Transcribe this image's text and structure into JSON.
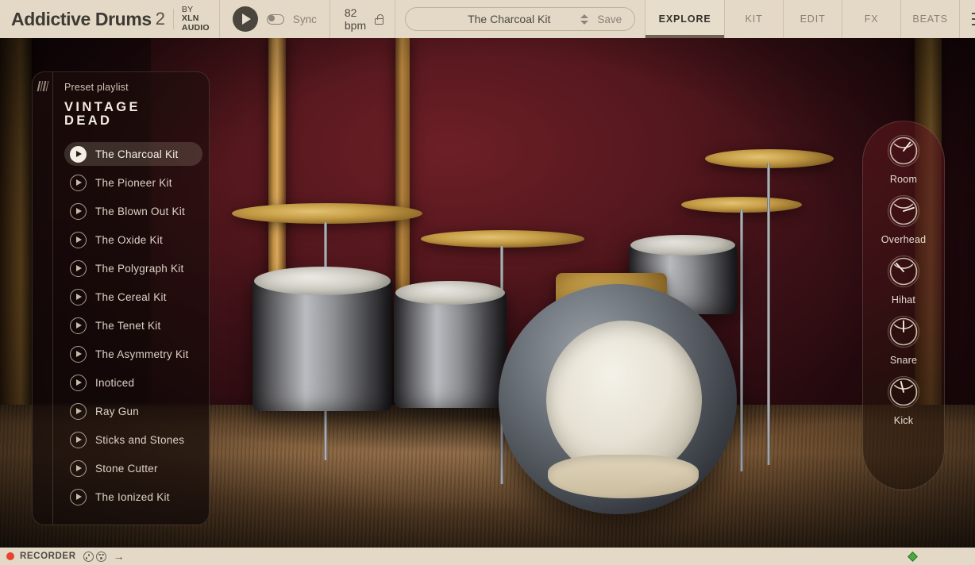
{
  "app": {
    "brand_name": "Addictive Drums",
    "brand_version": "2",
    "by_line1_prefix": "BY ",
    "by_line1_bold": "XLN",
    "by_line2": "AUDIO"
  },
  "transport": {
    "play_icon": "play-icon",
    "sync_label": "Sync",
    "sync_on": false,
    "bpm": "82 bpm",
    "lock_icon": "unlock-icon"
  },
  "preset": {
    "name": "The Charcoal Kit",
    "save_label": "Save",
    "stepper_icon": "chevron-up-down-icon"
  },
  "tabs": [
    {
      "label": "EXPLORE",
      "active": true
    },
    {
      "label": "KIT",
      "active": false
    },
    {
      "label": "EDIT",
      "active": false
    },
    {
      "label": "FX",
      "active": false
    },
    {
      "label": "BEATS",
      "active": false
    }
  ],
  "menu": {
    "icon": "hamburger-menu-icon"
  },
  "sidebar": {
    "kicker": "Preset playlist",
    "title_line1": "VINTAGE",
    "title_line2": "DEAD",
    "handle_icon": "drag-handle-icon",
    "items": [
      {
        "label": "The Charcoal Kit",
        "selected": true
      },
      {
        "label": "The Pioneer Kit",
        "selected": false
      },
      {
        "label": "The Blown Out Kit",
        "selected": false
      },
      {
        "label": "The Oxide Kit",
        "selected": false
      },
      {
        "label": "The Polygraph Kit",
        "selected": false
      },
      {
        "label": "The Cereal Kit",
        "selected": false
      },
      {
        "label": "The Tenet Kit",
        "selected": false
      },
      {
        "label": "The Asymmetry Kit",
        "selected": false
      },
      {
        "label": "Inoticed",
        "selected": false
      },
      {
        "label": "Ray Gun",
        "selected": false
      },
      {
        "label": "Sticks and Stones",
        "selected": false
      },
      {
        "label": "Stone Cutter",
        "selected": false
      },
      {
        "label": "The Ionized Kit",
        "selected": false
      }
    ]
  },
  "mixer": {
    "knobs": [
      {
        "label": "Room",
        "angle": 38
      },
      {
        "label": "Overhead",
        "angle": 72
      },
      {
        "label": "Hihat",
        "angle": -42
      },
      {
        "label": "Snare",
        "angle": 0
      },
      {
        "label": "Kick",
        "angle": -14
      }
    ]
  },
  "recorder": {
    "label": "RECORDER",
    "rec_dot_color": "#e8432f",
    "reel_icon_1": "tape-reel-icon",
    "reel_icon_2": "tape-reel-icon",
    "arrow": "→",
    "status_color": "#4fa83f"
  }
}
